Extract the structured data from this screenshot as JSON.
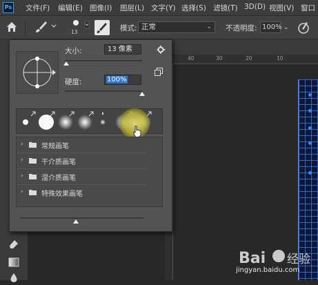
{
  "app": {
    "logo_text": "Ps"
  },
  "menu": {
    "items": [
      "文件(F)",
      "编辑(E)",
      "图像(I)",
      "图层(L)",
      "文字(Y)",
      "选择(S)",
      "滤镜(T)",
      "3D(D)",
      "视图(V)",
      "窗口"
    ]
  },
  "options_bar": {
    "brush_size_value": "13",
    "mode_label": "模式:",
    "mode_value": "正常",
    "opacity_label": "不透明度:",
    "opacity_value": "100%"
  },
  "ruler": {
    "numbers": [
      "40",
      "30",
      "20",
      "10"
    ]
  },
  "brush_panel": {
    "size_label": "大小:",
    "size_value": "13 像素",
    "size_slider_fraction": 0.02,
    "hardness_label": "硬度:",
    "hardness_value": "100%",
    "hardness_slider_fraction": 1.0,
    "presets": [
      "hard-small",
      "hard-large",
      "soft-medium",
      "soft-medium-2",
      "small-dot",
      "soft-large",
      "soft-large-selected"
    ],
    "groups": [
      "常规画笔",
      "干介质画笔",
      "湿介质画笔",
      "特殊效果画笔"
    ],
    "preview_slider_fraction": 0.45
  },
  "watermark": {
    "text": "jingyan.baidu.com"
  },
  "colors": {
    "accent": "#2f77d6",
    "panel_bg": "#535353",
    "canvas_bg": "#282828"
  }
}
